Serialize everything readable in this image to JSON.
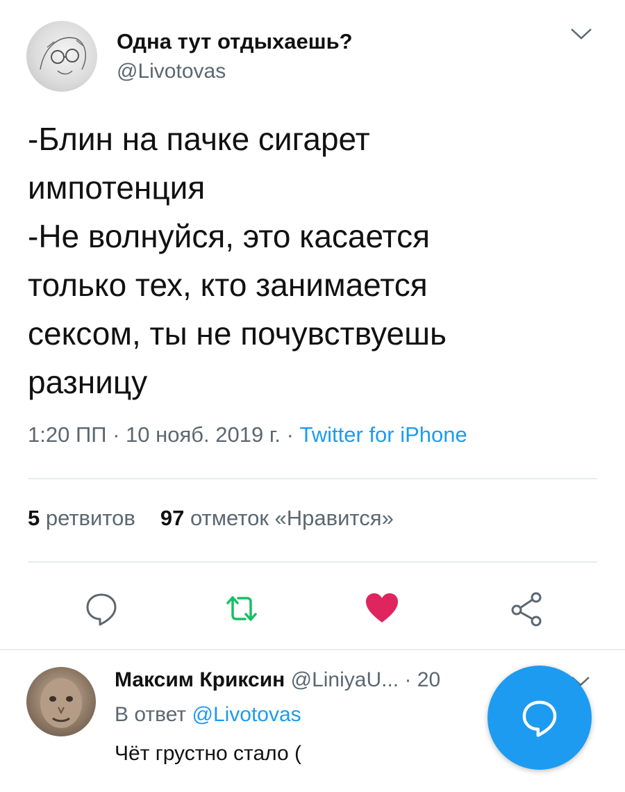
{
  "tweet": {
    "display_name": "Одна тут отдыхаешь?",
    "handle": "@Livotovas",
    "text": "-Блин на пачке сигарет\nимпотенция\n-Не волнуйся, это касается\nтолько тех, кто занимается\nсексом, ты не почувствуешь\nразницу",
    "time": "1:20 ПП · 10 нояб. 2019 г. · ",
    "source": "Twitter for iPhone",
    "retweets_count": "5",
    "retweets_label": "ретвитов",
    "likes_count": "97",
    "likes_label": "отметок «Нравится»"
  },
  "actions": {
    "reply_icon": "comment-icon",
    "retweet_icon": "retweet-icon",
    "like_icon": "heart-icon",
    "share_icon": "share-icon"
  },
  "reply": {
    "display_name": "Максим Криксин",
    "handle_truncated": "@LiniyaU...",
    "time_partial": " · 20",
    "in_reply_to_label": "В ответ",
    "in_reply_to_handle": "@Livotovas",
    "text": "Чёт грустно стало ("
  },
  "colors": {
    "accent": "#1d9bf0",
    "retweet": "#17bf63",
    "like": "#e0245e",
    "secondary_text": "#5b6770"
  }
}
